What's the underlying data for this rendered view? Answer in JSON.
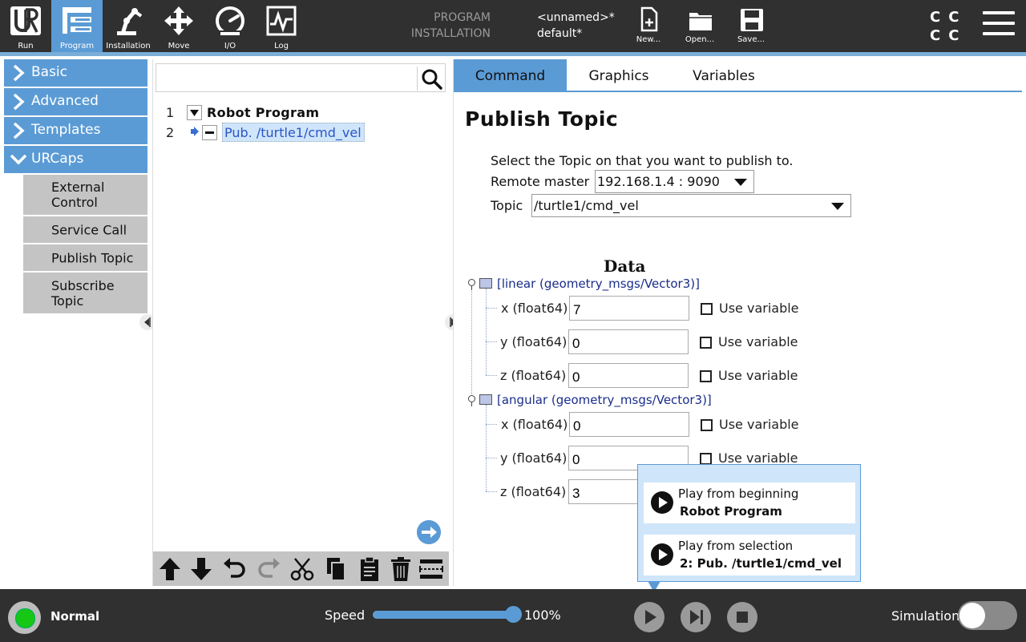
{
  "nav": {
    "run": "Run",
    "program": "Program",
    "installation": "Installation",
    "move": "Move",
    "io": "I/O",
    "log": "Log",
    "active": "program"
  },
  "program_info": {
    "program_key": "PROGRAM",
    "program_value": "<unnamed>*",
    "installation_key": "INSTALLATION",
    "installation_value": "default*"
  },
  "file_buttons": {
    "new": "New...",
    "open": "Open...",
    "save": "Save..."
  },
  "left_panel": {
    "categories": [
      {
        "label": "Basic",
        "expanded": false
      },
      {
        "label": "Advanced",
        "expanded": false
      },
      {
        "label": "Templates",
        "expanded": false
      },
      {
        "label": "URCaps",
        "expanded": true
      }
    ],
    "urcaps_items": [
      "External Control",
      "Service Call",
      "Publish Topic",
      "Subscribe Topic"
    ]
  },
  "tree": {
    "search_value": "",
    "rows": [
      {
        "num": "1",
        "label": "Robot Program"
      },
      {
        "num": "2",
        "label": "Pub. /turtle1/cmd_vel"
      }
    ]
  },
  "tabs": {
    "items": [
      "Command",
      "Graphics",
      "Variables"
    ],
    "active": "Command"
  },
  "command": {
    "title": "Publish Topic",
    "hint": "Select the Topic on that you want to publish to.",
    "remote_master_label": "Remote master",
    "remote_master_value": "192.168.1.4 : 9090",
    "topic_label": "Topic",
    "topic_value": "/turtle1/cmd_vel",
    "data_title": "Data",
    "use_variable_label": "Use variable",
    "groups": [
      {
        "label": "[linear (geometry_msgs/Vector3)]",
        "fields": [
          {
            "label": "x (float64)",
            "value": "7",
            "use_variable": false
          },
          {
            "label": "y (float64)",
            "value": "0",
            "use_variable": false
          },
          {
            "label": "z (float64)",
            "value": "0",
            "use_variable": false
          }
        ]
      },
      {
        "label": "[angular (geometry_msgs/Vector3)]",
        "fields": [
          {
            "label": "x (float64)",
            "value": "0",
            "use_variable": false
          },
          {
            "label": "y (float64)",
            "value": "0",
            "use_variable": false
          },
          {
            "label": "z (float64)",
            "value": "3",
            "use_variable": false
          }
        ]
      }
    ]
  },
  "play_popup": {
    "option1_line1": "Play from beginning",
    "option1_line2": "Robot Program",
    "option2_line1": "Play from selection",
    "option2_line2": "2: Pub. /turtle1/cmd_vel"
  },
  "bottom": {
    "status": "Normal",
    "speed_label": "Speed",
    "speed_value": "100%",
    "speed_fraction": 1.0,
    "simulation_label": "Simulation",
    "simulation_on": false
  },
  "colors": {
    "accent": "#5b9bd5",
    "bar_bg": "#303030",
    "status_green": "#16c716"
  }
}
